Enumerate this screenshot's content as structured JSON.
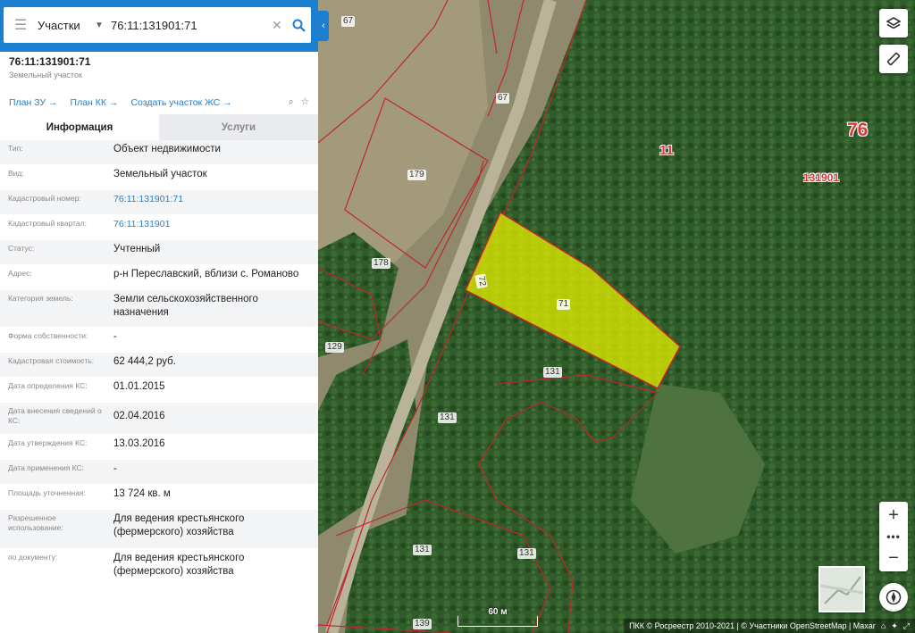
{
  "search": {
    "category": "Участки",
    "query": "76:11:131901:71"
  },
  "object": {
    "number": "76:11:131901:71",
    "kind": "Земельный участок"
  },
  "links": [
    "План ЗУ →",
    "План КК →",
    "Создать участок ЖС →"
  ],
  "tabs": {
    "info": "Информация",
    "services": "Услуги"
  },
  "details": [
    {
      "label": "Тип:",
      "value": "Объект недвижимости"
    },
    {
      "label": "Вид:",
      "value": "Земельный участок"
    },
    {
      "label": "Кадастровый номер:",
      "value": "76:11:131901:71"
    },
    {
      "label": "Кадастровый квартал:",
      "value": "76:11:131901"
    },
    {
      "label": "Статус:",
      "value": "Учтенный"
    },
    {
      "label": "Адрес:",
      "value": "р-н Переславский, вблизи с. Романово"
    },
    {
      "label": "Категория земель:",
      "value": "Земли сельскохозяйственного назначения"
    },
    {
      "label": "Форма собственности:",
      "value": "-"
    },
    {
      "label": "Кадастровая стоимость:",
      "value": "62 444,2 руб."
    },
    {
      "label": "Дата определения КС:",
      "value": "01.01.2015"
    },
    {
      "label": "Дата внесения сведений о КС:",
      "value": "02.04.2016"
    },
    {
      "label": "Дата утверждения КС:",
      "value": "13.03.2016"
    },
    {
      "label": "Дата применения КС:",
      "value": "-"
    },
    {
      "label": "Площадь уточненная:",
      "value": "13 724 кв. м"
    },
    {
      "label": "Разрешенное использование:",
      "value": "Для ведения крестьянского (фермерского) хозяйства"
    },
    {
      "label": "по документу:",
      "value": "Для ведения крестьянского (фермерского) хозяйства"
    }
  ],
  "map": {
    "parcel_labels": [
      "67",
      "67",
      "179",
      "178",
      "72",
      "71",
      "129",
      "131",
      "131",
      "131",
      "131",
      "139"
    ],
    "quarter_labels": [
      "76",
      "11",
      "131901"
    ],
    "scale": "60 м",
    "attribution": "ПКК © Росреестр 2010-2021 | © Участники OpenStreetMap | Maxar",
    "colors": {
      "boundary": "#c0262c",
      "selected_fill": "#e6f000",
      "accent": "#1d7fcf",
      "quarter_text": "#e03838"
    }
  },
  "icons": [
    "menu-icon",
    "search-icon",
    "clear-icon",
    "layers-icon",
    "ruler-icon",
    "zoom-in-icon",
    "zoom-out-icon",
    "compass-icon",
    "home-icon",
    "locate-icon",
    "fullscreen-icon"
  ]
}
